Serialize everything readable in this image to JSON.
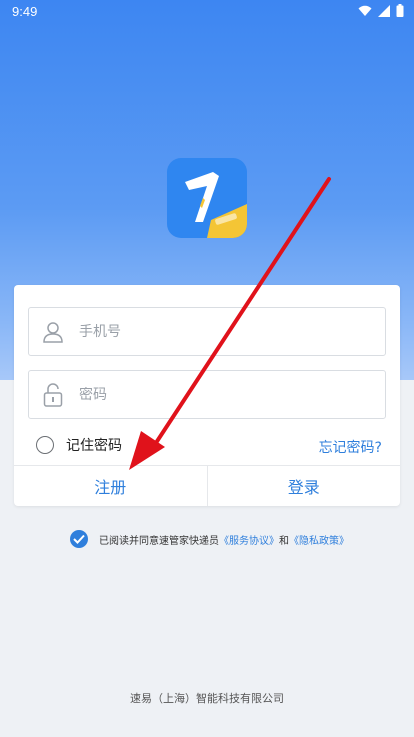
{
  "status_bar": {
    "time": "9:49"
  },
  "login": {
    "phone_placeholder": "手机号",
    "password_placeholder": "密码",
    "remember_label": "记住密码",
    "forgot_label": "忘记密码?",
    "register_label": "注册",
    "login_label": "登录"
  },
  "agreement": {
    "prefix": "已阅读并同意速管家快递员",
    "service_link": "《服务协议》",
    "connector": "和",
    "privacy_link": "《隐私政策》"
  },
  "footer": {
    "company": "速易（上海）智能科技有限公司"
  },
  "colors": {
    "primary": "#2f7fdc",
    "hero_top": "#3d86f2",
    "badge": "#f4c535",
    "arrow": "#e0121b"
  }
}
